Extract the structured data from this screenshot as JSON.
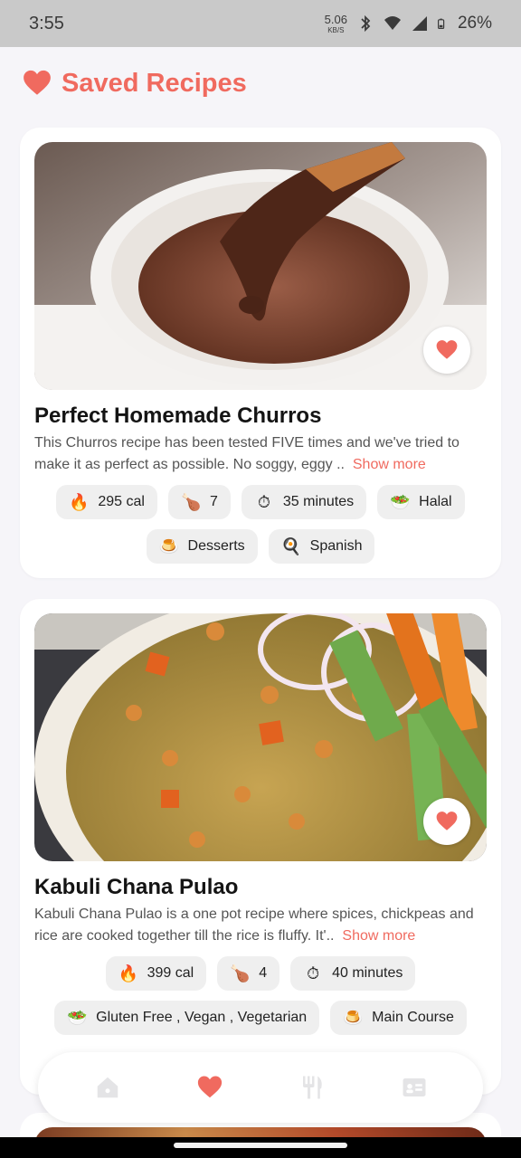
{
  "status_bar": {
    "time": "3:55",
    "net_speed_value": "5.06",
    "net_speed_unit": "KB/S",
    "battery": "26%",
    "icons": [
      "bluetooth-icon",
      "wifi-icon",
      "cell-signal-icon",
      "battery-icon"
    ]
  },
  "header": {
    "title": "Saved Recipes",
    "icon": "heart-icon",
    "accent_color": "#f06a5f"
  },
  "recipes": [
    {
      "title": "Perfect Homemade Churros",
      "description": "This Churros recipe has been tested FIVE times and we've tried to make it as perfect as possible. No soggy, eggy ..",
      "show_more": "Show more",
      "image_subject": "churro dipped in chocolate sauce",
      "favorite": true,
      "tags_row1": [
        {
          "icon": "fire-icon",
          "label": "295 cal"
        },
        {
          "icon": "drumstick-icon",
          "label": "7"
        },
        {
          "icon": "timer-icon",
          "label": "35 minutes"
        },
        {
          "icon": "halal-icon",
          "label": "Halal"
        }
      ],
      "tags_row2": [
        {
          "icon": "dessert-icon",
          "label": "Desserts"
        },
        {
          "icon": "cuisine-icon",
          "label": "Spanish"
        }
      ]
    },
    {
      "title": "Kabuli Chana Pulao",
      "description": "Kabuli Chana Pulao is a one pot recipe where spices, chickpeas and rice are cooked together till the rice is fluffy. It'..",
      "show_more": "Show more",
      "image_subject": "chickpea rice pulao with onion rings and cucumber",
      "favorite": true,
      "tags_row1": [
        {
          "icon": "fire-icon",
          "label": "399 cal"
        },
        {
          "icon": "drumstick-icon",
          "label": "4"
        },
        {
          "icon": "timer-icon",
          "label": "40 minutes"
        }
      ],
      "tags_row2": [
        {
          "icon": "diet-icon",
          "label": "Gluten Free , Vegan , Vegetarian"
        },
        {
          "icon": "course-icon",
          "label": "Main Course"
        }
      ]
    }
  ],
  "bottom_nav": [
    {
      "icon": "home-icon",
      "active": false
    },
    {
      "icon": "heart-icon",
      "active": true
    },
    {
      "icon": "fork-knife-icon",
      "active": false
    },
    {
      "icon": "profile-card-icon",
      "active": false
    }
  ]
}
